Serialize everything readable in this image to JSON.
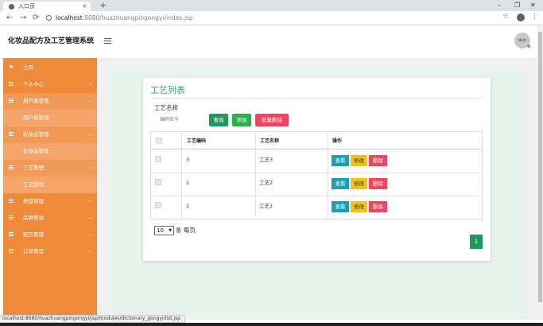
{
  "browser": {
    "tab_title": "入口页",
    "tab_close": "×",
    "new_tab": "+",
    "window_controls": [
      "–",
      "❐",
      "✕"
    ],
    "nav": [
      "←",
      "→",
      "⟳"
    ],
    "url_host": "localhost",
    "url_rest": ":8080/huazhuangpingongyi/index.jsp",
    "star": "☆",
    "menu": "⋮",
    "status_url": "localhost:8080/huazhuangpingongyi/jsp/modules/dictionary_gongyi/list.jsp"
  },
  "header": {
    "title": "化妆品配方及工艺管理系统",
    "avatar_text": "Math"
  },
  "sidebar": {
    "items": [
      {
        "label": "主页",
        "icon": "flag-icon",
        "glyph": "⚑"
      },
      {
        "label": "个人中心",
        "caret": "⌄"
      },
      {
        "label": "用户表管理",
        "caret": "⌄"
      },
      {
        "label": "用户表管理"
      },
      {
        "label": "化妆品管理",
        "caret": "⌄"
      },
      {
        "label": "化妆品管理"
      },
      {
        "label": "工艺管理",
        "caret": "⌄"
      },
      {
        "label": "工艺管理"
      },
      {
        "label": "类型管理",
        "caret": "⌄"
      },
      {
        "label": "品牌管理",
        "caret": "⌄"
      },
      {
        "label": "配方管理",
        "caret": "⌄"
      },
      {
        "label": "订单管理",
        "caret": "⌄"
      }
    ]
  },
  "main": {
    "title": "工艺列表",
    "search_label": "工艺名称",
    "search_placeholder": "编码名字",
    "buttons": {
      "query": "查询",
      "add": "添加",
      "bulk_delete": "批量删除"
    },
    "table": {
      "headers": [
        "工艺编码",
        "工艺名称",
        "操作"
      ],
      "rows": [
        {
          "code": "3",
          "name": "工艺3"
        },
        {
          "code": "2",
          "name": "工艺2"
        },
        {
          "code": "1",
          "name": "工艺1"
        }
      ],
      "row_buttons": {
        "view": "查看",
        "edit": "修改",
        "delete": "删除"
      }
    },
    "page_size": "10",
    "page_size_suffix": "条 每页",
    "current_page": "1"
  },
  "colors": {
    "sidebar": "#ef8a3a",
    "accent_green": "#1e9a5e",
    "danger": "#f2455d",
    "warning": "#f5c20f",
    "info": "#1c9eb4"
  }
}
